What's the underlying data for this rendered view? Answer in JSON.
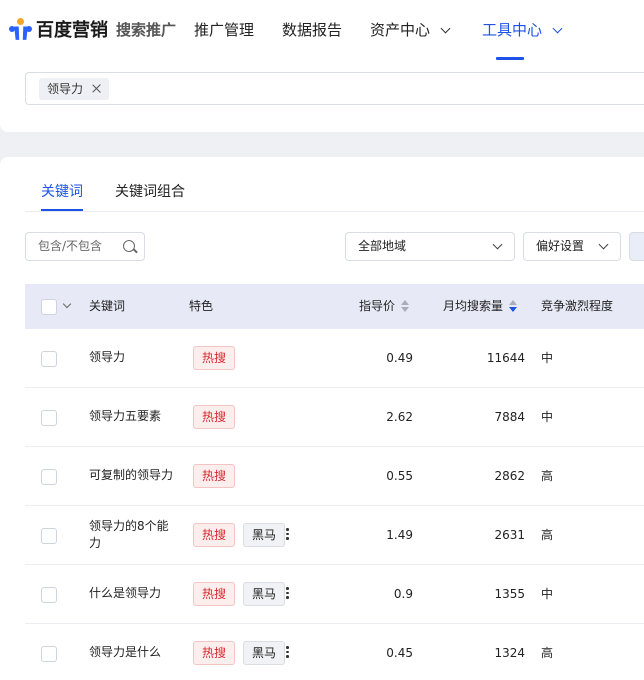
{
  "header": {
    "brand": "百度营销",
    "product": "搜索推广",
    "nav": [
      {
        "label": "推广管理"
      },
      {
        "label": "数据报告"
      },
      {
        "label": "资产中心"
      },
      {
        "label": "工具中心"
      }
    ]
  },
  "search": {
    "tags": [
      {
        "label": "领导力"
      }
    ]
  },
  "tabs": [
    {
      "label": "关键词",
      "active": true
    },
    {
      "label": "关键词组合",
      "active": false
    }
  ],
  "filters": {
    "include_placeholder": "包含/不包含",
    "region": "全部地域",
    "preference": "偏好设置"
  },
  "table": {
    "columns": {
      "keyword": "关键词",
      "feature": "特色",
      "price": "指导价",
      "volume": "月均搜索量",
      "competition": "竞争激烈程度"
    },
    "rows": [
      {
        "keyword": "领导力",
        "hot": "热搜",
        "dark": "",
        "price": "0.49",
        "volume": "11644",
        "competition": "中"
      },
      {
        "keyword": "领导力五要素",
        "hot": "热搜",
        "dark": "",
        "price": "2.62",
        "volume": "7884",
        "competition": "中"
      },
      {
        "keyword": "可复制的领导力",
        "hot": "热搜",
        "dark": "",
        "price": "0.55",
        "volume": "2862",
        "competition": "高"
      },
      {
        "keyword": "领导力的8个能力",
        "hot": "热搜",
        "dark": "黑马",
        "price": "1.49",
        "volume": "2631",
        "competition": "高"
      },
      {
        "keyword": "什么是领导力",
        "hot": "热搜",
        "dark": "黑马",
        "price": "0.9",
        "volume": "1355",
        "competition": "中"
      },
      {
        "keyword": "领导力是什么",
        "hot": "热搜",
        "dark": "黑马",
        "price": "0.45",
        "volume": "1324",
        "competition": "高"
      }
    ]
  },
  "colors": {
    "accent": "#1c53e6",
    "hot_text": "#d9282f",
    "table_header_bg": "#e7eaf6"
  }
}
